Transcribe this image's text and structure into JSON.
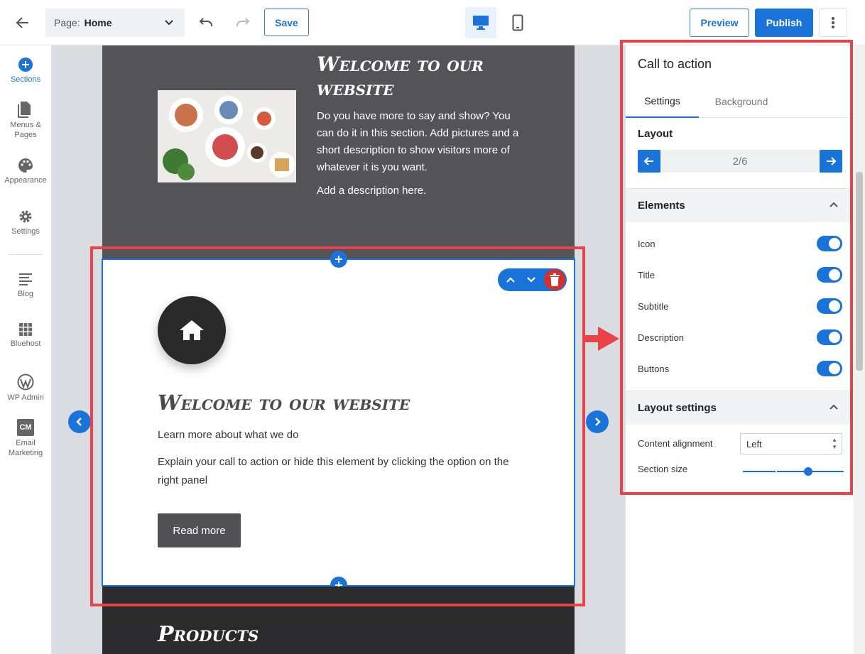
{
  "topbar": {
    "page_label": "Page:",
    "page_value": "Home",
    "save_label": "Save",
    "preview_label": "Preview",
    "publish_label": "Publish"
  },
  "sidebar": {
    "items": [
      {
        "label": "Sections",
        "icon": "plus-circle-icon"
      },
      {
        "label": "Menus & Pages",
        "icon": "pages-icon"
      },
      {
        "label": "Appearance",
        "icon": "palette-icon"
      },
      {
        "label": "Settings",
        "icon": "gear-icon"
      },
      {
        "label": "Blog",
        "icon": "blog-icon"
      },
      {
        "label": "Bluehost",
        "icon": "grid-icon"
      },
      {
        "label": "WP Admin",
        "icon": "wordpress-icon"
      },
      {
        "label": "Email Marketing",
        "icon": "cm-icon"
      }
    ],
    "cm_badge": "CM"
  },
  "canvas": {
    "hero": {
      "title": "Welcome to our website",
      "body": "Do you have more to say and show? You can do it in this section. Add pictures and a short description to show visitors more of whatever it is you want.",
      "description": "Add a description here."
    },
    "cta": {
      "title": "Welcome to our website",
      "subtitle": "Learn more about what we do",
      "description": "Explain your call to action or hide this element by clicking the option on the right panel",
      "button": "Read more"
    },
    "next_section_title": "Products"
  },
  "panel": {
    "title": "Call to action",
    "tabs": [
      {
        "label": "Settings",
        "active": true
      },
      {
        "label": "Background",
        "active": false
      }
    ],
    "layout_label": "Layout",
    "layout_value": "2/6",
    "elements_header": "Elements",
    "elements": [
      {
        "label": "Icon",
        "on": true
      },
      {
        "label": "Title",
        "on": true
      },
      {
        "label": "Subtitle",
        "on": true
      },
      {
        "label": "Description",
        "on": true
      },
      {
        "label": "Buttons",
        "on": true
      }
    ],
    "layout_settings_header": "Layout settings",
    "content_alignment_label": "Content alignment",
    "content_alignment_value": "Left",
    "section_size_label": "Section size",
    "section_size_fraction": 0.65
  },
  "colors": {
    "accent": "#1a73d9",
    "highlight": "#e9434a",
    "delete": "#d2312f",
    "hero_bg": "#545458"
  }
}
